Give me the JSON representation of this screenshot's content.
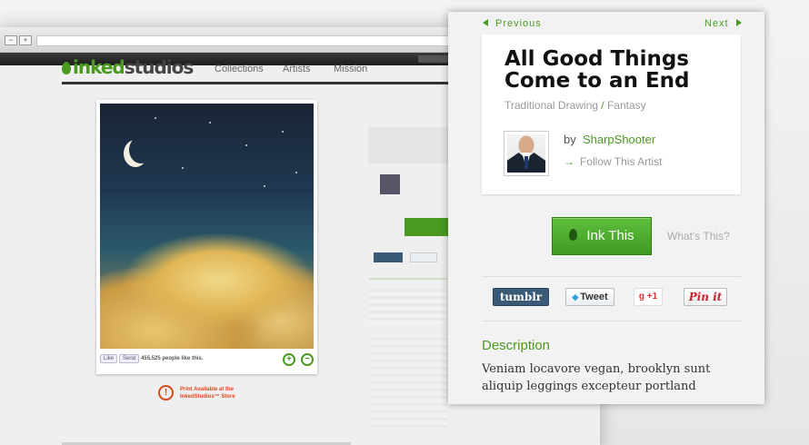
{
  "background_site": {
    "logo_prefix": "inked",
    "logo_suffix": "studios",
    "nav": [
      "Collections",
      "Artists",
      "Mission"
    ],
    "photo_social": {
      "like": "Like",
      "send": "Send",
      "count_text": "455,525 people like this."
    },
    "print_notice": "Print Available at the InkedStudios™ Store"
  },
  "panel": {
    "prev_label": "Previous",
    "next_label": "Next",
    "title": "All Good Things Come to an End",
    "category": "Traditional Drawing",
    "category_sep": " / ",
    "subcategory": "Fantasy",
    "by_label": "by",
    "artist": "SharpShooter",
    "follow_label": "Follow This Artist",
    "ink_button": "Ink This",
    "whats_this": "What's This?",
    "share": {
      "tumblr": "tumblr",
      "tweet": "Tweet",
      "gplus": "+1",
      "pin": "Pin it"
    },
    "description_heading": "Description",
    "description_text": "Veniam locavore vegan, brooklyn sunt aliquip leggings excepteur portland gluten-free"
  },
  "colors": {
    "accent": "#4a9a22",
    "alert": "#d84a1b",
    "title": "#111111"
  }
}
